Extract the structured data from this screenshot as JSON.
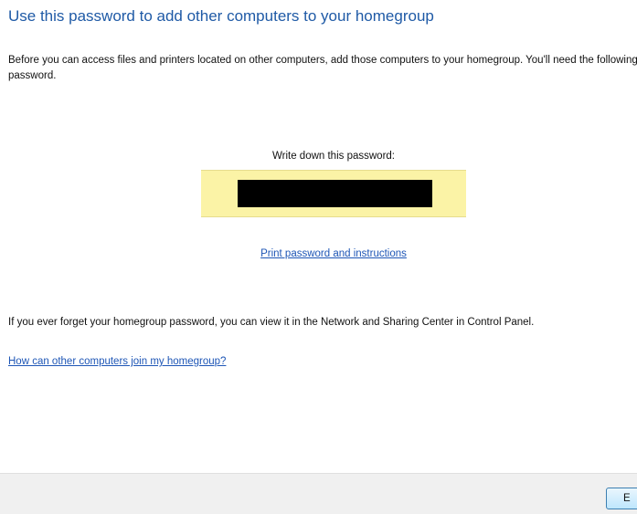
{
  "header": {
    "title": "Use this password to add other computers to your homegroup"
  },
  "intro": {
    "text": "Before you can access files and printers located on other computers, add those computers to your homegroup.  You'll need the following password."
  },
  "password_panel": {
    "label": "Write down this password:"
  },
  "links": {
    "print": "Print password and instructions",
    "help": "How can other computers join my homegroup?"
  },
  "forget_note": {
    "text": "If you ever forget your homegroup password, you can view it in the Network and Sharing Center in Control Panel."
  },
  "footer": {
    "button_label": "E"
  },
  "colors": {
    "title": "#1f5aa6",
    "link": "#1e56b6",
    "password_highlight": "#fbf3a6",
    "footer_bg": "#f0f0f0"
  }
}
